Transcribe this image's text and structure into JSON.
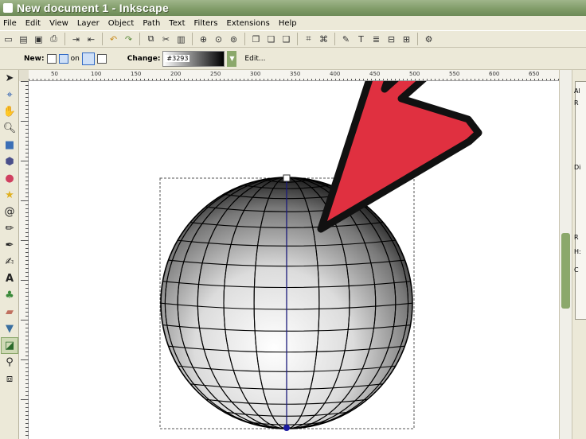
{
  "window": {
    "title": "New document 1 - Inkscape"
  },
  "menu": [
    "File",
    "Edit",
    "View",
    "Layer",
    "Object",
    "Path",
    "Text",
    "Filters",
    "Extensions",
    "Help"
  ],
  "toolbar": {
    "icons": [
      "new-icon",
      "open-icon",
      "save-icon",
      "print-icon",
      "import-icon",
      "export-icon",
      "undo-icon",
      "redo-icon",
      "copy-icon",
      "cut-icon",
      "paste-icon",
      "zoom-selection-icon",
      "zoom-drawing-icon",
      "zoom-page-icon",
      "duplicate-icon",
      "clone-icon",
      "unlink-clone-icon",
      "group-icon",
      "ungroup-icon",
      "fill-stroke-icon",
      "text-font-icon",
      "layers-icon",
      "xml-editor-icon",
      "align-icon",
      "preferences-icon"
    ]
  },
  "controls": {
    "new_label": "New:",
    "on_label": "on",
    "change_label": "Change:",
    "color_code": "#3293",
    "edit_label": "Edit..."
  },
  "tools": [
    "selector",
    "node",
    "tweak",
    "zoom",
    "rectangle",
    "3d-box",
    "ellipse",
    "star",
    "spiral",
    "pencil",
    "pen",
    "calligraphy",
    "text",
    "spray",
    "eraser",
    "paint-bucket",
    "gradient",
    "dropper",
    "connector"
  ],
  "active_tool": "gradient",
  "ruler": {
    "labels": [
      "50",
      "100",
      "150",
      "200",
      "250",
      "300",
      "350",
      "400",
      "450",
      "500",
      "550",
      "600",
      "650"
    ]
  },
  "dock": {
    "fragments": [
      "Al",
      "R",
      "Di",
      "R",
      "H:",
      "C"
    ]
  },
  "colors": {
    "arrow_fill": "#e03040",
    "title_bar": "#7e9a66",
    "accent": "#8ba86b"
  }
}
